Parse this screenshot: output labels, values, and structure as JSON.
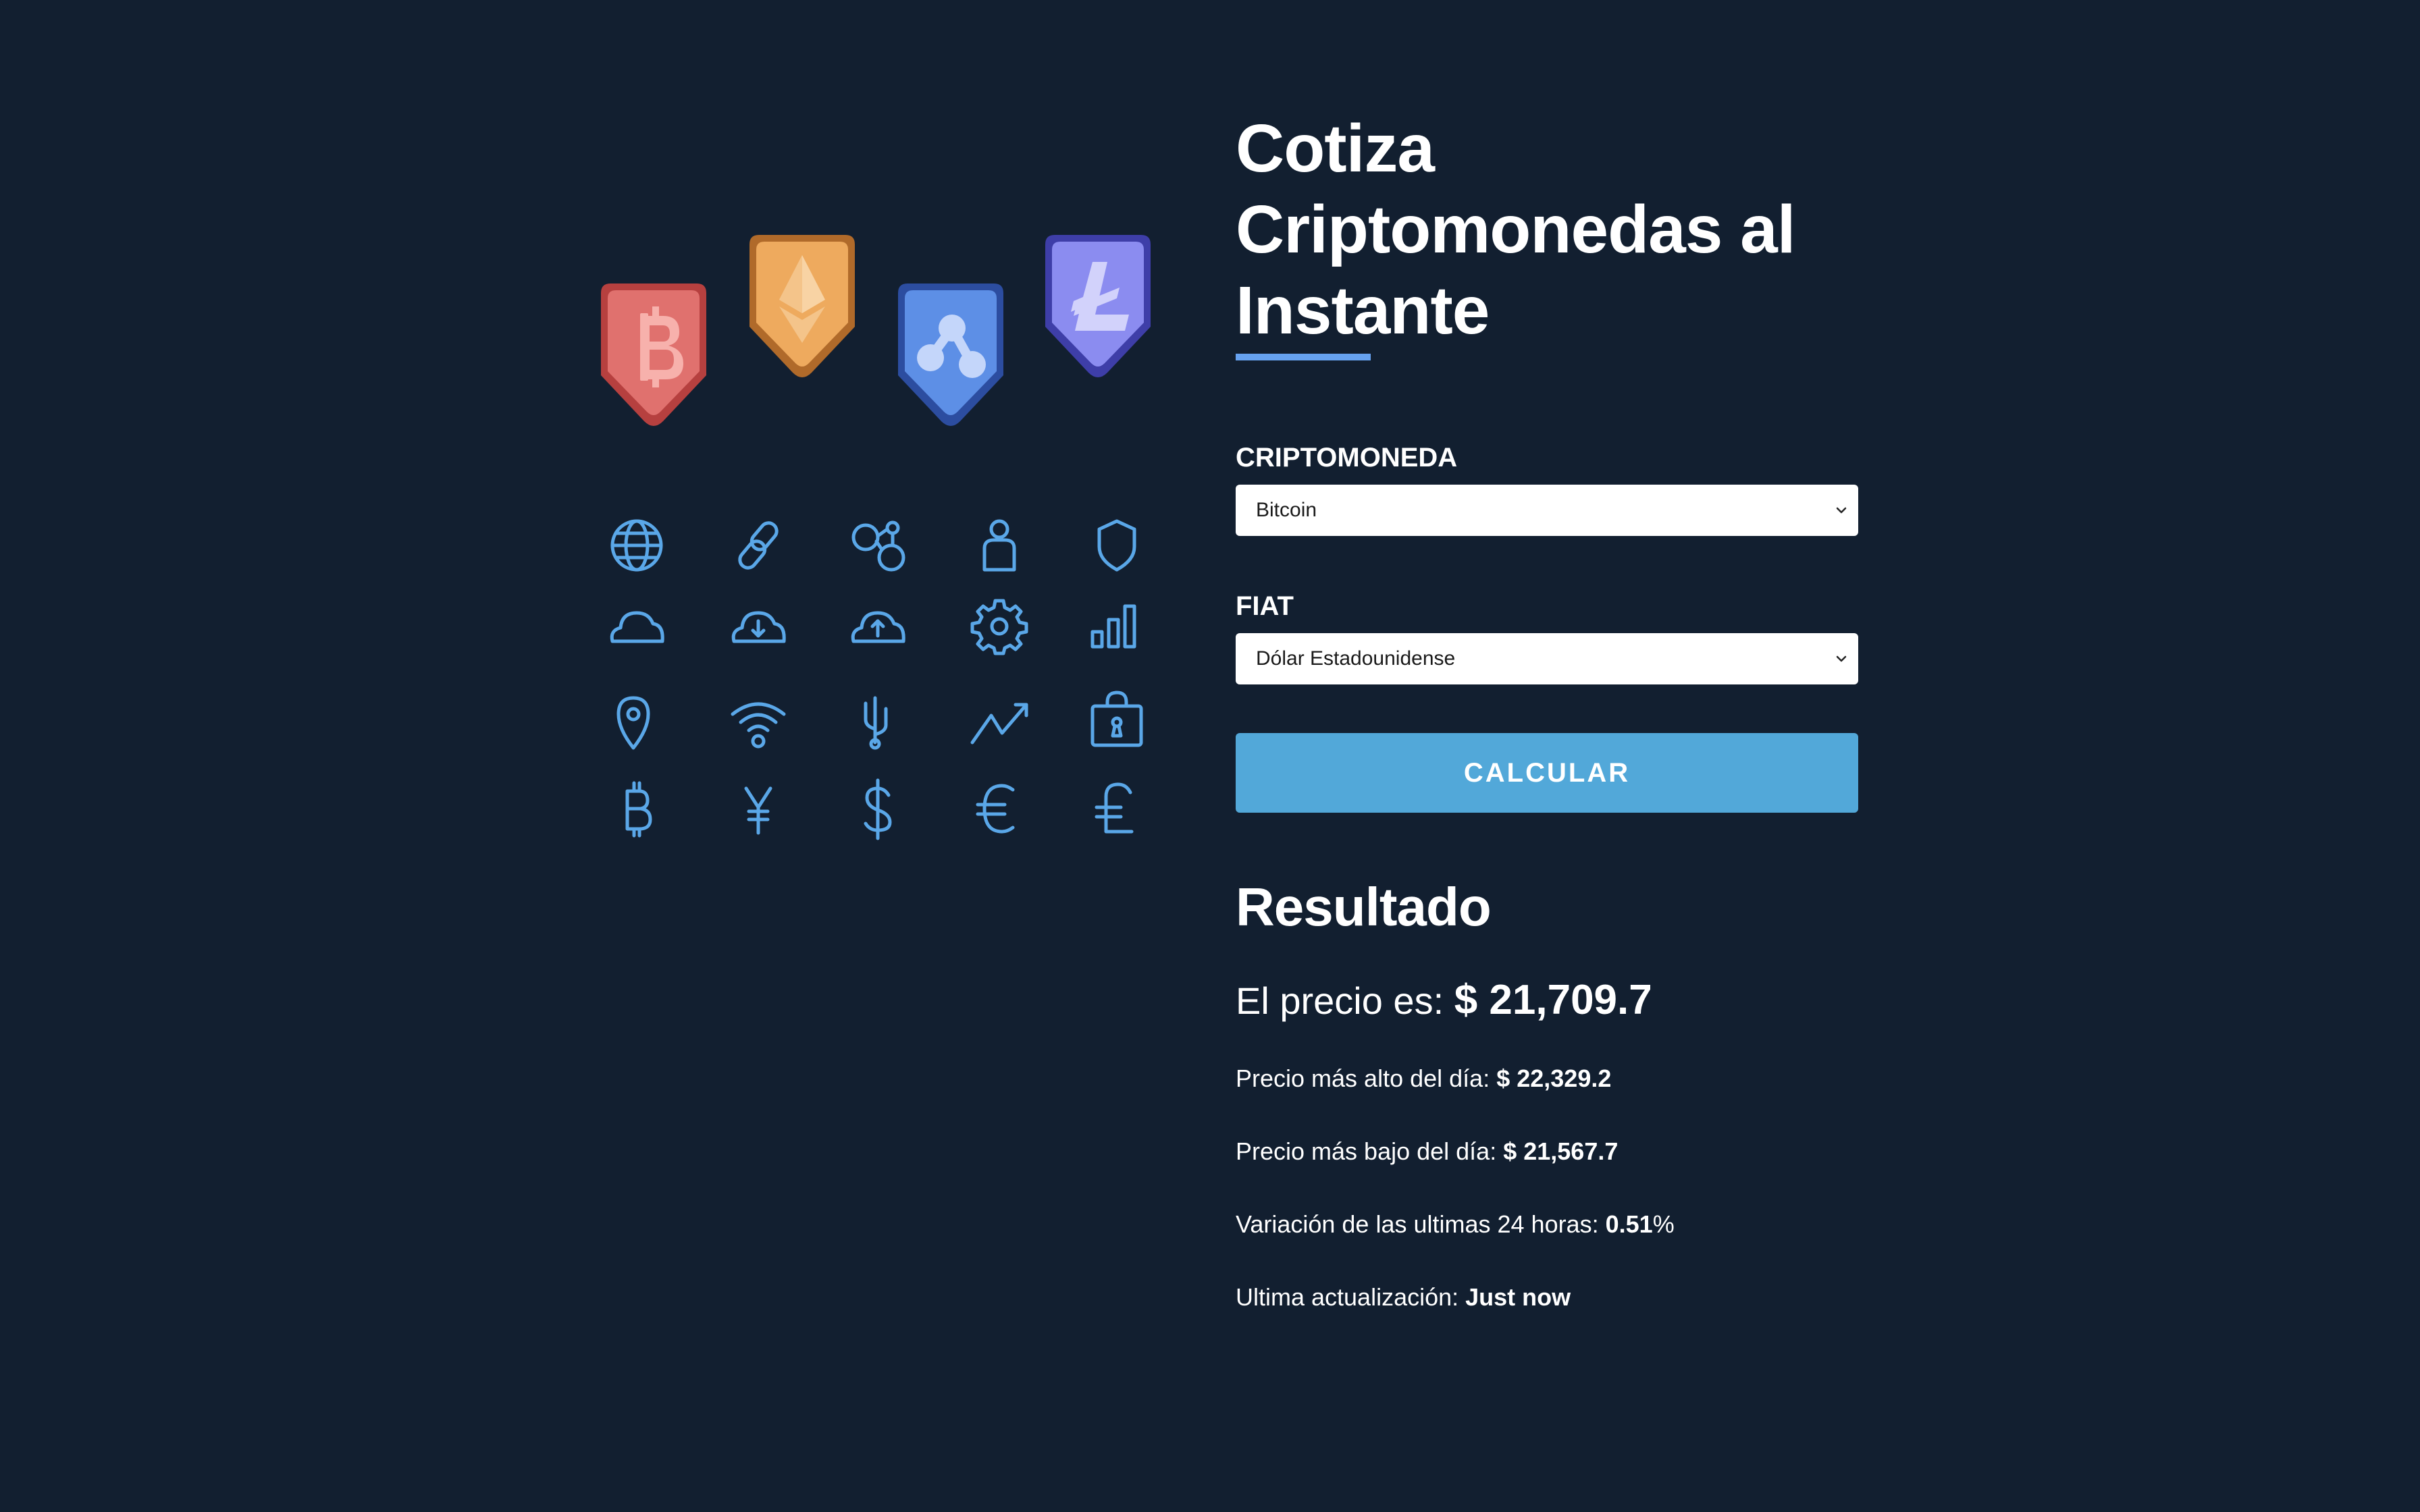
{
  "title": {
    "line1": "Cotiza",
    "line2": "Criptomonedas al",
    "line3": "Instante"
  },
  "form": {
    "crypto_label": "CRIPTOMONEDA",
    "crypto_selected": "Bitcoin",
    "fiat_label": "FIAT",
    "fiat_selected": "Dólar Estadounidense",
    "submit_label": "CALCULAR"
  },
  "result": {
    "title": "Resultado",
    "price_label": "El precio es: ",
    "price_value": "$ 21,709.7",
    "high_label": "Precio más alto del día: ",
    "high_value": "$ 22,329.2",
    "low_label": "Precio más bajo del día: ",
    "low_value": "$ 21,567.7",
    "change_label": "Variación de las ultimas 24 horas: ",
    "change_value": "0.51",
    "change_suffix": "%",
    "updated_label": "Ultima actualización: ",
    "updated_value": "Just now"
  },
  "illustration": {
    "badges": [
      "bitcoin-badge",
      "ethereum-badge",
      "ripple-badge",
      "litecoin-badge"
    ],
    "icons": [
      "globe-icon",
      "link-icon",
      "nodes-icon",
      "user-icon",
      "shield-icon",
      "cloud-icon",
      "cloud-download-icon",
      "cloud-upload-icon",
      "gear-icon",
      "bar-chart-icon",
      "map-pin-icon",
      "wifi-icon",
      "usb-icon",
      "trend-up-icon",
      "lock-icon",
      "bitcoin-icon",
      "yen-icon",
      "dollar-icon",
      "euro-icon",
      "pound-icon"
    ],
    "colors": {
      "bitcoin": "#e0716e",
      "ethereum": "#eeaa5e",
      "ripple": "#5d8fe6",
      "litecoin": "#8b8cf0",
      "icon_stroke": "#5aa7e8"
    }
  },
  "colors": {
    "background": "#121f30",
    "accent": "#66a2f0",
    "button": "#52a8d9"
  }
}
